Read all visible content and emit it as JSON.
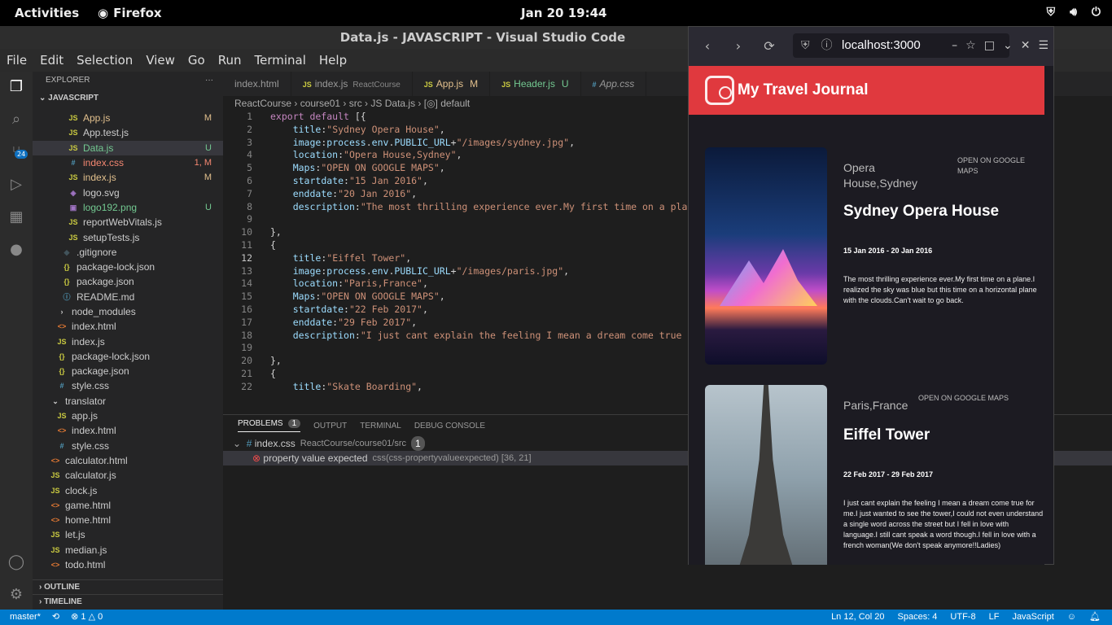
{
  "topbar": {
    "activities": "Activities",
    "app": "Firefox",
    "clock": "Jan 20  19:44"
  },
  "vscode": {
    "title": "Data.js - JAVASCRIPT - Visual Studio Code",
    "menu": [
      "File",
      "Edit",
      "Selection",
      "View",
      "Go",
      "Run",
      "Terminal",
      "Help"
    ],
    "scm_badge": "24",
    "explorer": {
      "header": "EXPLORER",
      "more": "···",
      "root": "JAVASCRIPT",
      "files": [
        {
          "name": "App.js",
          "icon": "JS",
          "cls": "ijs",
          "status": "M",
          "indent": 34
        },
        {
          "name": "App.test.js",
          "icon": "JS",
          "cls": "ijs",
          "status": "",
          "indent": 34
        },
        {
          "name": "Data.js",
          "icon": "JS",
          "cls": "ijs",
          "status": "U",
          "indent": 34,
          "selected": true
        },
        {
          "name": "index.css",
          "icon": "#",
          "cls": "icss",
          "status": "1, M",
          "indent": 34,
          "error": true
        },
        {
          "name": "index.js",
          "icon": "JS",
          "cls": "ijs",
          "status": "M",
          "indent": 34
        },
        {
          "name": "logo.svg",
          "icon": "◈",
          "cls": "isvg",
          "status": "",
          "indent": 34
        },
        {
          "name": "logo192.png",
          "icon": "▣",
          "cls": "ipng",
          "status": "U",
          "indent": 34
        },
        {
          "name": "reportWebVitals.js",
          "icon": "JS",
          "cls": "ijs",
          "status": "",
          "indent": 34
        },
        {
          "name": "setupTests.js",
          "icon": "JS",
          "cls": "ijs",
          "status": "",
          "indent": 34
        },
        {
          "name": ".gitignore",
          "icon": "◆",
          "cls": "igit",
          "status": "",
          "indent": 26
        },
        {
          "name": "package-lock.json",
          "icon": "{}",
          "cls": "ijson",
          "status": "",
          "indent": 26
        },
        {
          "name": "package.json",
          "icon": "{}",
          "cls": "ijson",
          "status": "",
          "indent": 26
        },
        {
          "name": "README.md",
          "icon": "ⓘ",
          "cls": "imd",
          "status": "",
          "indent": 26
        },
        {
          "name": "node_modules",
          "icon": "›",
          "cls": "",
          "status": "",
          "indent": 20
        },
        {
          "name": "index.html",
          "icon": "<>",
          "cls": "ihtml",
          "status": "",
          "indent": 20
        },
        {
          "name": "index.js",
          "icon": "JS",
          "cls": "ijs",
          "status": "",
          "indent": 20
        },
        {
          "name": "package-lock.json",
          "icon": "{}",
          "cls": "ijson",
          "status": "",
          "indent": 20
        },
        {
          "name": "package.json",
          "icon": "{}",
          "cls": "ijson",
          "status": "",
          "indent": 20
        },
        {
          "name": "style.css",
          "icon": "#",
          "cls": "icss",
          "status": "",
          "indent": 20
        },
        {
          "name": "translator",
          "icon": "⌄",
          "cls": "",
          "status": "",
          "indent": 12
        },
        {
          "name": "app.js",
          "icon": "JS",
          "cls": "ijs",
          "status": "",
          "indent": 20
        },
        {
          "name": "index.html",
          "icon": "<>",
          "cls": "ihtml",
          "status": "",
          "indent": 20
        },
        {
          "name": "style.css",
          "icon": "#",
          "cls": "icss",
          "status": "",
          "indent": 20
        },
        {
          "name": "calculator.html",
          "icon": "<>",
          "cls": "ihtml",
          "status": "",
          "indent": 12
        },
        {
          "name": "calculator.js",
          "icon": "JS",
          "cls": "ijs",
          "status": "",
          "indent": 12
        },
        {
          "name": "clock.js",
          "icon": "JS",
          "cls": "ijs",
          "status": "",
          "indent": 12
        },
        {
          "name": "game.html",
          "icon": "<>",
          "cls": "ihtml",
          "status": "",
          "indent": 12
        },
        {
          "name": "home.html",
          "icon": "<>",
          "cls": "ihtml",
          "status": "",
          "indent": 12
        },
        {
          "name": "let.js",
          "icon": "JS",
          "cls": "ijs",
          "status": "",
          "indent": 12
        },
        {
          "name": "median.js",
          "icon": "JS",
          "cls": "ijs",
          "status": "",
          "indent": 12
        },
        {
          "name": "todo.html",
          "icon": "<>",
          "cls": "ihtml",
          "status": "",
          "indent": 12
        }
      ],
      "outline": "OUTLINE",
      "timeline": "TIMELINE"
    },
    "tabs": [
      {
        "label": "index.html",
        "icon": "",
        "sub": "",
        "mark": ""
      },
      {
        "label": "index.js",
        "icon": "JS",
        "sub": "ReactCourse",
        "mark": ""
      },
      {
        "label": "App.js",
        "icon": "JS",
        "sub": "",
        "mark": "M"
      },
      {
        "label": "Header.js",
        "icon": "JS",
        "sub": "",
        "mark": "U"
      },
      {
        "label": "App.css",
        "icon": "#",
        "sub": "",
        "mark": ""
      }
    ],
    "breadcrumb": "ReactCourse  ›  course01  ›  src  ›  JS Data.js  ›  [◎] default",
    "code": [
      {
        "n": "1",
        "html": "<span class='k'>export default</span> [{"
      },
      {
        "n": "2",
        "html": "    <span class='p'>title</span>:<span class='s'>\"Sydney Opera House\"</span>,"
      },
      {
        "n": "3",
        "html": "    <span class='p'>image</span>:<span class='p'>process</span>.<span class='p'>env</span>.<span class='p'>PUBLIC_URL</span>+<span class='s'>\"/images/sydney.jpg\"</span>,"
      },
      {
        "n": "4",
        "html": "    <span class='p'>location</span>:<span class='s'>\"Opera House,Sydney\"</span>,"
      },
      {
        "n": "5",
        "html": "    <span class='p'>Maps</span>:<span class='s'>\"OPEN ON GOOGLE MAPS\"</span>,"
      },
      {
        "n": "6",
        "html": "    <span class='p'>startdate</span>:<span class='s'>\"15 Jan 2016\"</span>,"
      },
      {
        "n": "7",
        "html": "    <span class='p'>enddate</span>:<span class='s'>\"20 Jan 2016\"</span>,"
      },
      {
        "n": "8",
        "html": "    <span class='p'>description</span>:<span class='s'>\"The most thrilling experience ever.My first time on a pla</span>"
      },
      {
        "n": "9",
        "html": ""
      },
      {
        "n": "10",
        "html": "},"
      },
      {
        "n": "11",
        "html": "{"
      },
      {
        "n": "12",
        "html": "    <span class='p'>title</span>:<span class='s'>\"Eiffel Tower\"</span>,",
        "cur": true
      },
      {
        "n": "13",
        "html": "    <span class='p'>image</span>:<span class='p'>process</span>.<span class='p'>env</span>.<span class='p'>PUBLIC_URL</span>+<span class='s'>\"/images/paris.jpg\"</span>,"
      },
      {
        "n": "14",
        "html": "    <span class='p'>location</span>:<span class='s'>\"Paris,France\"</span>,"
      },
      {
        "n": "15",
        "html": "    <span class='p'>Maps</span>:<span class='s'>\"OPEN ON GOOGLE MAPS\"</span>,"
      },
      {
        "n": "16",
        "html": "    <span class='p'>startdate</span>:<span class='s'>\"22 Feb 2017\"</span>,"
      },
      {
        "n": "17",
        "html": "    <span class='p'>enddate</span>:<span class='s'>\"29 Feb 2017\"</span>,"
      },
      {
        "n": "18",
        "html": "    <span class='p'>description</span>:<span class='s'>\"I just cant explain the feeling I mean a dream come true</span>"
      },
      {
        "n": "19",
        "html": ""
      },
      {
        "n": "20",
        "html": "},"
      },
      {
        "n": "21",
        "html": "{"
      },
      {
        "n": "22",
        "html": "    <span class='p'>title</span>:<span class='s'>\"Skate Boarding\"</span>,"
      }
    ],
    "panel": {
      "tabs": [
        "PROBLEMS",
        "OUTPUT",
        "TERMINAL",
        "DEBUG CONSOLE"
      ],
      "problem_count": "1",
      "file": "index.css",
      "file_path": "ReactCourse/course01/src",
      "file_count": "1",
      "error": "property value expected",
      "error_src": "css(css-propertyvalueexpected)  [36, 21]"
    },
    "status": {
      "branch": "master*",
      "errors": "⊗ 1 △ 0",
      "position": "Ln 12, Col 20",
      "spaces": "Spaces: 4",
      "encoding": "UTF-8",
      "eol": "LF",
      "language": "JavaScript"
    }
  },
  "firefox": {
    "url": "localhost:3000",
    "app_title": "My Travel Journal",
    "cards": [
      {
        "location": "Opera House,Sydney",
        "maps": "OPEN ON GOOGLE MAPS",
        "title": "Sydney Opera House",
        "dates": "15 Jan 2016 - 20 Jan 2016",
        "description": "The most thrilling experience ever.My first time on a plane.I realized the sky was blue but this time on a horizontal plane with the clouds.Can't wait to go back."
      },
      {
        "location": "Paris,France",
        "maps": "OPEN ON GOOGLE MAPS",
        "title": "Eiffel Tower",
        "dates": "22 Feb 2017 - 29 Feb 2017",
        "description": "I just cant explain the feeling I mean a dream come true for me.I just wanted to see the tower,I could not even understand a single word across the street but I fell in love with language.I still cant speak a word though.I fell in love with a french woman(We don't speak anymore!!Ladies)"
      }
    ]
  }
}
